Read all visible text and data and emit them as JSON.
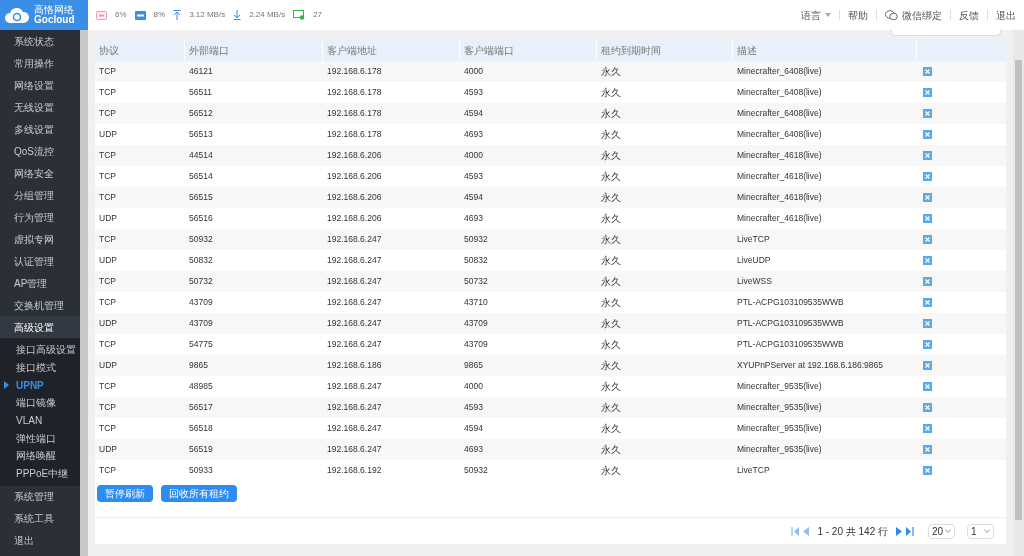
{
  "logo": {
    "cn": "高恪网络",
    "en": "Gocloud"
  },
  "status": {
    "cpu": "6%",
    "ram": "8%",
    "up": "3.12 MB/s",
    "down": "2.24 MB/s",
    "clients": "27"
  },
  "top_links": [
    {
      "kind": "dropdown",
      "label": "语言"
    },
    {
      "kind": "plain",
      "label": "帮助"
    },
    {
      "kind": "wechat",
      "label": "微信绑定"
    },
    {
      "kind": "plain",
      "label": "反馈"
    },
    {
      "kind": "plain",
      "label": "退出"
    }
  ],
  "sidebar": [
    {
      "label": "系统状态",
      "expanded": false
    },
    {
      "label": "常用操作",
      "expanded": false
    },
    {
      "label": "网络设置",
      "expanded": false
    },
    {
      "label": "无线设置",
      "expanded": false
    },
    {
      "label": "多线设置",
      "expanded": false
    },
    {
      "label": "QoS流控",
      "expanded": false
    },
    {
      "label": "网络安全",
      "expanded": false
    },
    {
      "label": "分组管理",
      "expanded": false
    },
    {
      "label": "行为管理",
      "expanded": false
    },
    {
      "label": "虚拟专网",
      "expanded": false
    },
    {
      "label": "认证管理",
      "expanded": false
    },
    {
      "label": "AP管理",
      "expanded": false
    },
    {
      "label": "交换机管理",
      "expanded": false
    },
    {
      "label": "高级设置",
      "expanded": true,
      "children": [
        {
          "label": "接口高级设置",
          "selected": false
        },
        {
          "label": "接口模式",
          "selected": false
        },
        {
          "label": "UPNP",
          "selected": true
        },
        {
          "label": "端口镜像",
          "selected": false
        },
        {
          "label": "VLAN",
          "selected": false
        },
        {
          "label": "弹性端口",
          "selected": false
        },
        {
          "label": "网络唤醒",
          "selected": false
        },
        {
          "label": "PPPoE中继",
          "selected": false
        }
      ]
    },
    {
      "label": "系统管理",
      "expanded": false
    },
    {
      "label": "系统工具",
      "expanded": false
    },
    {
      "label": "退出",
      "expanded": false
    }
  ],
  "table": {
    "columns": [
      "协议",
      "外部端口",
      "客户端地址",
      "客户端端口",
      "租约到期时间",
      "描述"
    ],
    "rows": [
      [
        "TCP",
        "46121",
        "192.168.6.178",
        "4000",
        "永久",
        "Minecrafter_6408(live)"
      ],
      [
        "TCP",
        "56511",
        "192.168.6.178",
        "4593",
        "永久",
        "Minecrafter_6408(live)"
      ],
      [
        "TCP",
        "56512",
        "192.168.6.178",
        "4594",
        "永久",
        "Minecrafter_6408(live)"
      ],
      [
        "UDP",
        "56513",
        "192.168.6.178",
        "4693",
        "永久",
        "Minecrafter_6408(live)"
      ],
      [
        "TCP",
        "44514",
        "192.168.6.206",
        "4000",
        "永久",
        "Minecrafter_4618(live)"
      ],
      [
        "TCP",
        "56514",
        "192.168.6.206",
        "4593",
        "永久",
        "Minecrafter_4618(live)"
      ],
      [
        "TCP",
        "56515",
        "192.168.6.206",
        "4594",
        "永久",
        "Minecrafter_4618(live)"
      ],
      [
        "UDP",
        "56516",
        "192.168.6.206",
        "4693",
        "永久",
        "Minecrafter_4618(live)"
      ],
      [
        "TCP",
        "50932",
        "192.168.6.247",
        "50932",
        "永久",
        "LiveTCP"
      ],
      [
        "UDP",
        "50832",
        "192.168.6.247",
        "50832",
        "永久",
        "LiveUDP"
      ],
      [
        "TCP",
        "50732",
        "192.168.6.247",
        "50732",
        "永久",
        "LiveWSS"
      ],
      [
        "TCP",
        "43709",
        "192.168.6.247",
        "43710",
        "永久",
        "PTL-ACPG103109535WWB"
      ],
      [
        "UDP",
        "43709",
        "192.168.6.247",
        "43709",
        "永久",
        "PTL-ACPG103109535WWB"
      ],
      [
        "TCP",
        "54775",
        "192.168.6.247",
        "43709",
        "永久",
        "PTL-ACPG103109535WWB"
      ],
      [
        "UDP",
        "9865",
        "192.168.6.186",
        "9865",
        "永久",
        "XYUPnPServer at 192.168.6.186:9865"
      ],
      [
        "TCP",
        "48985",
        "192.168.6.247",
        "4000",
        "永久",
        "Minecrafter_9535(live)"
      ],
      [
        "TCP",
        "56517",
        "192.168.6.247",
        "4593",
        "永久",
        "Minecrafter_9535(live)"
      ],
      [
        "TCP",
        "56518",
        "192.168.6.247",
        "4594",
        "永久",
        "Minecrafter_9535(live)"
      ],
      [
        "UDP",
        "56519",
        "192.168.6.247",
        "4693",
        "永久",
        "Minecrafter_9535(live)"
      ],
      [
        "TCP",
        "50933",
        "192.168.6.192",
        "50932",
        "永久",
        "LiveTCP"
      ]
    ]
  },
  "buttons": [
    "暂停刷新",
    "回收所有租约"
  ],
  "pagination": {
    "info": "1 - 20 共 142 行",
    "page_size": "20",
    "page": "1"
  }
}
